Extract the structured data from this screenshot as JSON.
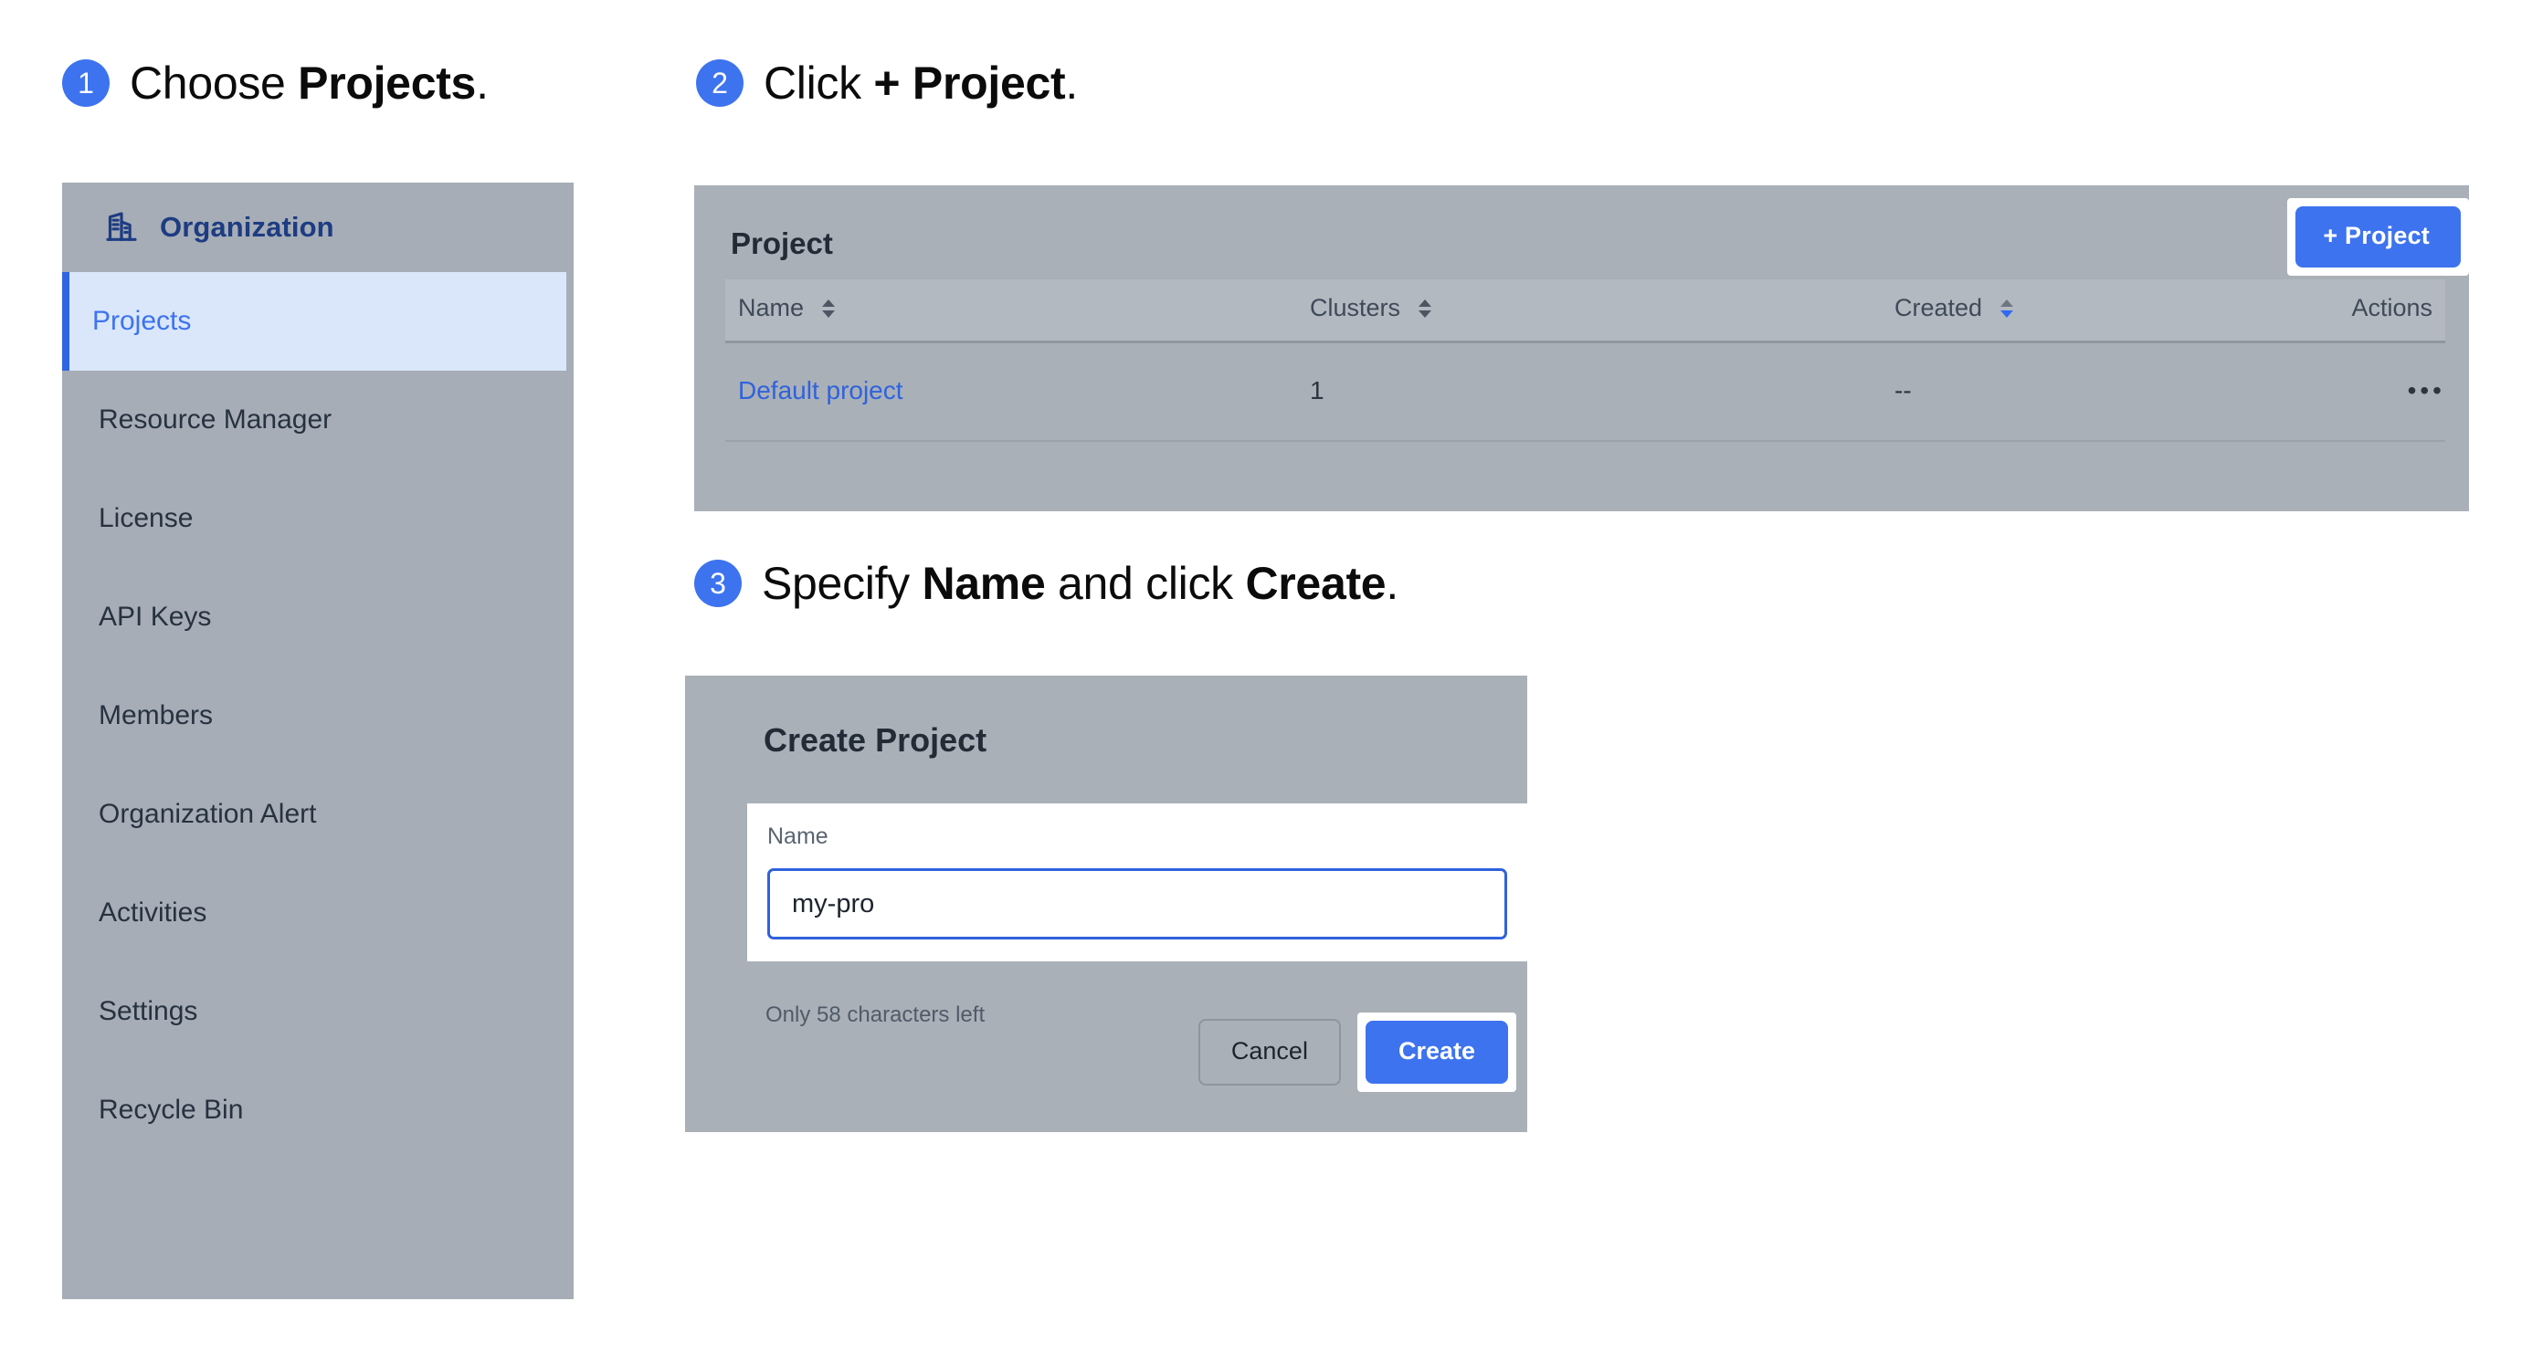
{
  "steps": [
    {
      "number": "1",
      "prefix": "Choose ",
      "strong": "Projects",
      "suffix": "."
    },
    {
      "number": "2",
      "prefix": "Click ",
      "strong": "+ Project",
      "suffix": "."
    },
    {
      "number": "3",
      "prefix": "Specify ",
      "strong": "Name",
      "mid": " and click ",
      "strong2": "Create",
      "suffix": "."
    }
  ],
  "sidebar": {
    "org_icon": "building-icon",
    "org_label": "Organization",
    "items": [
      {
        "label": "Projects",
        "active": true
      },
      {
        "label": "Resource Manager",
        "active": false
      },
      {
        "label": "License",
        "active": false
      },
      {
        "label": "API Keys",
        "active": false
      },
      {
        "label": "Members",
        "active": false
      },
      {
        "label": "Organization Alert",
        "active": false
      },
      {
        "label": "Activities",
        "active": false
      },
      {
        "label": "Settings",
        "active": false
      },
      {
        "label": "Recycle Bin",
        "active": false
      }
    ]
  },
  "project_panel": {
    "title": "Project",
    "add_button_label": "+ Project",
    "columns": [
      {
        "label": "Name",
        "sortable": true,
        "sort_state": "none"
      },
      {
        "label": "Clusters",
        "sortable": true,
        "sort_state": "none"
      },
      {
        "label": "Created",
        "sortable": true,
        "sort_state": "desc"
      },
      {
        "label": "Actions",
        "sortable": false,
        "sort_state": "none"
      }
    ],
    "rows": [
      {
        "name": "Default project",
        "clusters": "1",
        "created": "--",
        "actions": "•••"
      }
    ]
  },
  "create_dialog": {
    "title": "Create Project",
    "name_label": "Name",
    "name_value": "my-pro",
    "name_placeholder": "",
    "char_hint": "Only 58 characters left",
    "cancel_label": "Cancel",
    "create_label": "Create"
  },
  "colors": {
    "accent_blue": "#3d73ee",
    "panel_gray": "#a9b0b8",
    "sidebar_gray": "#a6adb6",
    "active_item_bg": "#dae7fb",
    "link_blue": "#2f62dc",
    "org_navy": "#1d3c82"
  }
}
